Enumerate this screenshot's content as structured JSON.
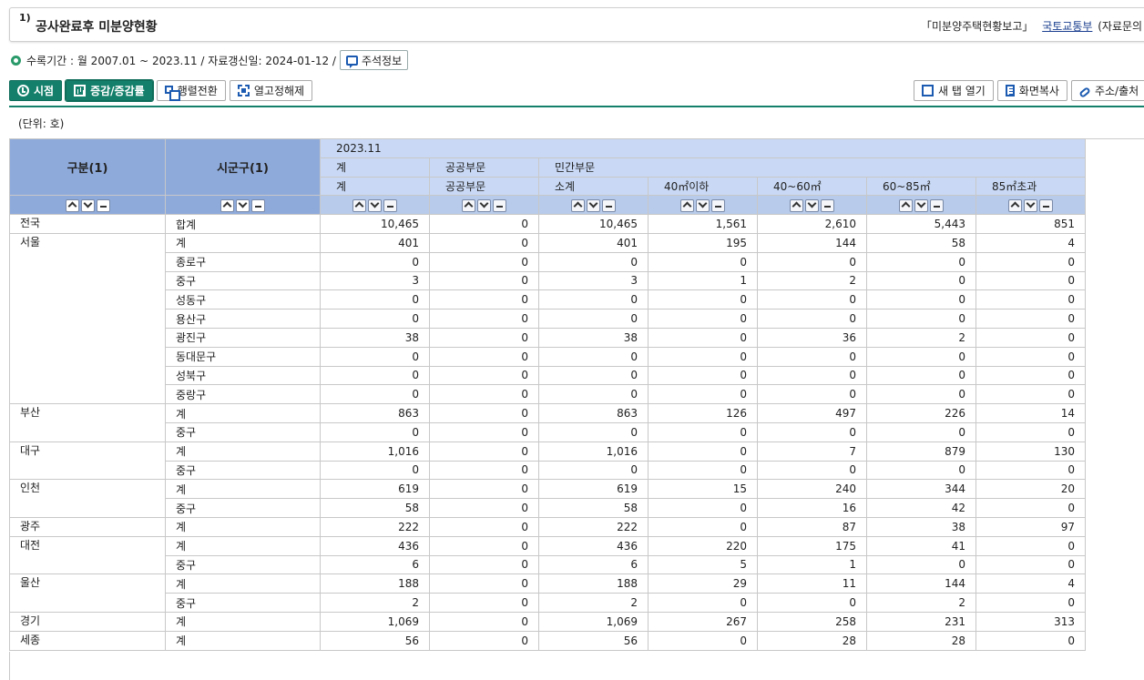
{
  "title": {
    "number": "1)",
    "text": "공사완료후 미분양현황",
    "source_report": "「미분양주택현황보고」",
    "source_org": "국토교통부",
    "source_extra": "(자료문의"
  },
  "info": {
    "text": "수록기간 : 월 2007.01 ~ 2023.11 / 자료갱신일: 2024-01-12 /",
    "note_button": "주석정보"
  },
  "toolbar": {
    "point_label": "시점",
    "change_label": "증감/증감률",
    "pivot_label": "행렬전환",
    "unfix_label": "열고정해제",
    "newtab_label": "새 탭 열기",
    "copy_label": "화면복사",
    "address_label": "주소/출처"
  },
  "unit": "(단위: 호)",
  "table": {
    "left_headers": [
      "구분(1)",
      "시군구(1)"
    ],
    "period": "2023.11",
    "group_headers": [
      "계",
      "공공부문",
      "민간부문"
    ],
    "column_headers": [
      "계",
      "공공부문",
      "소계",
      "40㎡이하",
      "40~60㎡",
      "60~85㎡",
      "85㎡초과"
    ],
    "regions": [
      {
        "name": "전국",
        "rows": [
          {
            "sub": "합계",
            "values": [
              "10,465",
              "0",
              "10,465",
              "1,561",
              "2,610",
              "5,443",
              "851"
            ]
          }
        ]
      },
      {
        "name": "서울",
        "rows": [
          {
            "sub": "계",
            "values": [
              "401",
              "0",
              "401",
              "195",
              "144",
              "58",
              "4"
            ]
          },
          {
            "sub": "종로구",
            "values": [
              "0",
              "0",
              "0",
              "0",
              "0",
              "0",
              "0"
            ]
          },
          {
            "sub": "중구",
            "values": [
              "3",
              "0",
              "3",
              "1",
              "2",
              "0",
              "0"
            ]
          },
          {
            "sub": "성동구",
            "values": [
              "0",
              "0",
              "0",
              "0",
              "0",
              "0",
              "0"
            ]
          },
          {
            "sub": "용산구",
            "values": [
              "0",
              "0",
              "0",
              "0",
              "0",
              "0",
              "0"
            ]
          },
          {
            "sub": "광진구",
            "values": [
              "38",
              "0",
              "38",
              "0",
              "36",
              "2",
              "0"
            ]
          },
          {
            "sub": "동대문구",
            "values": [
              "0",
              "0",
              "0",
              "0",
              "0",
              "0",
              "0"
            ]
          },
          {
            "sub": "성북구",
            "values": [
              "0",
              "0",
              "0",
              "0",
              "0",
              "0",
              "0"
            ]
          },
          {
            "sub": "중랑구",
            "values": [
              "0",
              "0",
              "0",
              "0",
              "0",
              "0",
              "0"
            ]
          }
        ]
      },
      {
        "name": "부산",
        "rows": [
          {
            "sub": "계",
            "values": [
              "863",
              "0",
              "863",
              "126",
              "497",
              "226",
              "14"
            ]
          },
          {
            "sub": "중구",
            "values": [
              "0",
              "0",
              "0",
              "0",
              "0",
              "0",
              "0"
            ]
          }
        ]
      },
      {
        "name": "대구",
        "rows": [
          {
            "sub": "계",
            "values": [
              "1,016",
              "0",
              "1,016",
              "0",
              "7",
              "879",
              "130"
            ]
          },
          {
            "sub": "중구",
            "values": [
              "0",
              "0",
              "0",
              "0",
              "0",
              "0",
              "0"
            ]
          }
        ]
      },
      {
        "name": "인천",
        "rows": [
          {
            "sub": "계",
            "values": [
              "619",
              "0",
              "619",
              "15",
              "240",
              "344",
              "20"
            ]
          },
          {
            "sub": "중구",
            "values": [
              "58",
              "0",
              "58",
              "0",
              "16",
              "42",
              "0"
            ]
          }
        ]
      },
      {
        "name": "광주",
        "rows": [
          {
            "sub": "계",
            "values": [
              "222",
              "0",
              "222",
              "0",
              "87",
              "38",
              "97"
            ]
          }
        ]
      },
      {
        "name": "대전",
        "rows": [
          {
            "sub": "계",
            "values": [
              "436",
              "0",
              "436",
              "220",
              "175",
              "41",
              "0"
            ]
          },
          {
            "sub": "중구",
            "values": [
              "6",
              "0",
              "6",
              "5",
              "1",
              "0",
              "0"
            ]
          }
        ]
      },
      {
        "name": "울산",
        "rows": [
          {
            "sub": "계",
            "values": [
              "188",
              "0",
              "188",
              "29",
              "11",
              "144",
              "4"
            ]
          },
          {
            "sub": "중구",
            "values": [
              "2",
              "0",
              "2",
              "0",
              "0",
              "2",
              "0"
            ]
          }
        ]
      },
      {
        "name": "경기",
        "rows": [
          {
            "sub": "계",
            "values": [
              "1,069",
              "0",
              "1,069",
              "267",
              "258",
              "231",
              "313"
            ]
          }
        ]
      },
      {
        "name": "세종",
        "rows": [
          {
            "sub": "계",
            "values": [
              "56",
              "0",
              "56",
              "0",
              "28",
              "28",
              "0"
            ]
          }
        ]
      }
    ]
  }
}
